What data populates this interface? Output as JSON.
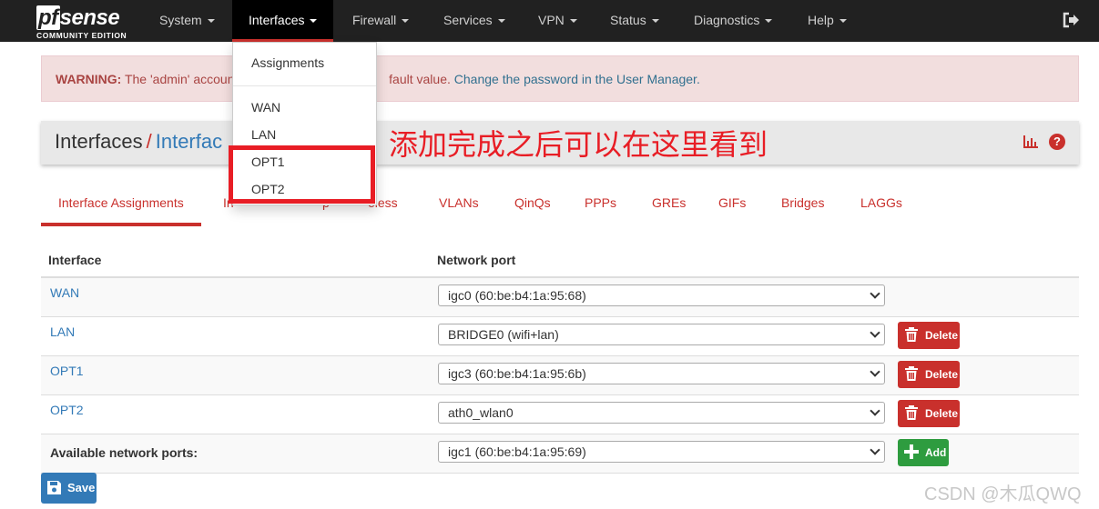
{
  "brand": {
    "name_pf": "pf",
    "name_rest": "sense",
    "edition": "COMMUNITY EDITION"
  },
  "nav": {
    "items": [
      {
        "label": "System"
      },
      {
        "label": "Interfaces"
      },
      {
        "label": "Firewall"
      },
      {
        "label": "Services"
      },
      {
        "label": "VPN"
      },
      {
        "label": "Status"
      },
      {
        "label": "Diagnostics"
      },
      {
        "label": "Help"
      }
    ],
    "active": "Interfaces"
  },
  "interfaces_menu": {
    "items": [
      {
        "label": "Assignments"
      },
      {
        "label": "WAN"
      },
      {
        "label": "LAN"
      },
      {
        "label": "OPT1"
      },
      {
        "label": "OPT2"
      }
    ]
  },
  "alert": {
    "prefix": "WARNING:",
    "text_before": "The 'admin' account",
    "text_after": "fault value.",
    "link": "Change the password in the User Manager."
  },
  "breadcrumb": {
    "root": "Interfaces",
    "separator": "/",
    "current": "Interfac"
  },
  "annotation": "添加完成之后可以在这里看到",
  "tabs": {
    "items": [
      {
        "label": "Interface Assignments"
      },
      {
        "label": "In"
      },
      {
        "label": "p"
      },
      {
        "label": "eless"
      },
      {
        "label": "VLANs"
      },
      {
        "label": "QinQs"
      },
      {
        "label": "PPPs"
      },
      {
        "label": "GREs"
      },
      {
        "label": "GIFs"
      },
      {
        "label": "Bridges"
      },
      {
        "label": "LAGGs"
      }
    ],
    "active": "Interface Assignments"
  },
  "table": {
    "headers": {
      "interface": "Interface",
      "network_port": "Network port"
    },
    "rows": [
      {
        "interface": "WAN",
        "port": "igc0 (60:be:b4:1a:95:68)"
      },
      {
        "interface": "LAN",
        "port": "BRIDGE0 (wifi+lan)",
        "action": "Delete"
      },
      {
        "interface": "OPT1",
        "port": "igc3 (60:be:b4:1a:95:6b)",
        "action": "Delete"
      },
      {
        "interface": "OPT2",
        "port": "ath0_wlan0",
        "action": "Delete"
      }
    ],
    "available": {
      "label": "Available network ports:",
      "port": "igc1 (60:be:b4:1a:95:69)",
      "action": "Add"
    }
  },
  "save_label": "Save",
  "watermark": "CSDN @木瓜QWQ",
  "colors": {
    "navbar": "#212121",
    "accent": "#c9302c",
    "link": "#337ab7",
    "success": "#2e9c3f",
    "annotation": "#e81d25"
  }
}
